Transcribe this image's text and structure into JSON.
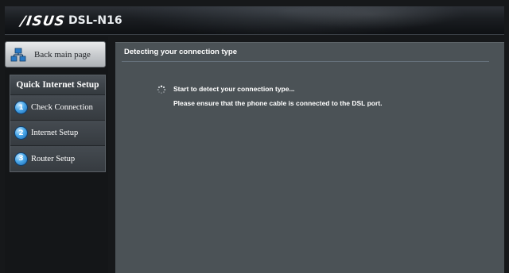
{
  "header": {
    "brand": "/ISUS",
    "model": "DSL-N16"
  },
  "sidebar": {
    "back_button_label": "Back main page",
    "back_button_icon": "network-icon",
    "qis_title": "Quick Internet Setup",
    "items": [
      {
        "number": "1",
        "label": "Check Connection"
      },
      {
        "number": "2",
        "label": "Internet Setup"
      },
      {
        "number": "3",
        "label": "Router Setup"
      }
    ]
  },
  "main": {
    "title": "Detecting your connection type",
    "status_line": "Start to detect your connection type...",
    "instruction_line": "Please ensure that the phone cable is connected to the DSL port."
  },
  "colors": {
    "main_panel": "#4b5256",
    "sidebar_panel": "#3c4247",
    "step_icon": "#4aa7e8",
    "background": "#16181a"
  }
}
